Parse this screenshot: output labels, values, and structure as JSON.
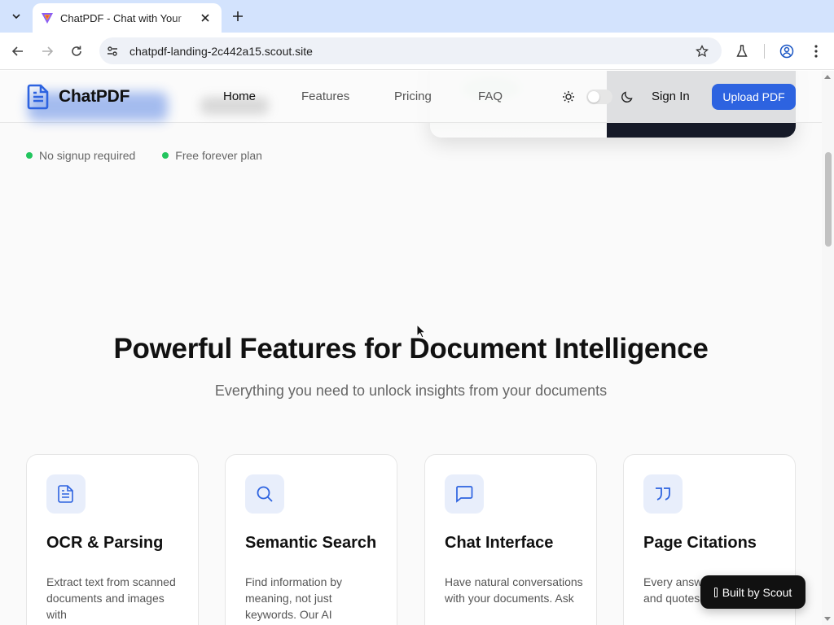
{
  "browser": {
    "tab_title": "ChatPDF - Chat with Your",
    "url": "chatpdf-landing-2c442a15.scout.site"
  },
  "header": {
    "logo_text": "ChatPDF",
    "nav": [
      {
        "label": "Home",
        "active": true
      },
      {
        "label": "Features",
        "active": false
      },
      {
        "label": "Pricing",
        "active": false
      },
      {
        "label": "FAQ",
        "active": false
      }
    ],
    "sign_in": "Sign In",
    "upload": "Upload PDF"
  },
  "perks": [
    "No signup required",
    "Free forever plan"
  ],
  "features": {
    "title": "Powerful Features for Document Intelligence",
    "subtitle": "Everything you need to unlock insights from your documents",
    "cards": [
      {
        "icon": "document-icon",
        "title": "OCR & Parsing",
        "desc": "Extract text from scanned documents and images with"
      },
      {
        "icon": "search-icon",
        "title": "Semantic Search",
        "desc": "Find information by meaning, not just keywords. Our AI"
      },
      {
        "icon": "chat-icon",
        "title": "Chat Interface",
        "desc": "Have natural conversations with your documents. Ask"
      },
      {
        "icon": "quote-icon",
        "title": "Page Citations",
        "desc": "Every answer exact page and quotes. Verify"
      }
    ]
  },
  "badge": "Built by Scout",
  "colors": {
    "accent": "#2d63e0",
    "perk_dot": "#22c55e",
    "tab_strip": "#d3e3fd"
  }
}
